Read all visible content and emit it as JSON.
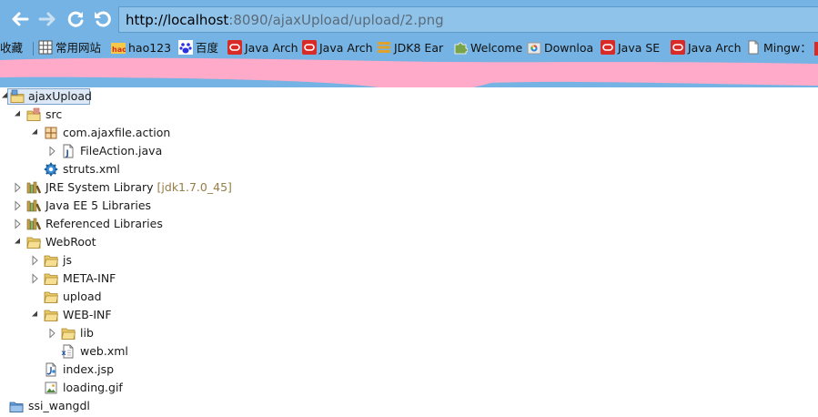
{
  "address": {
    "host_part": "http://localhost",
    "rest_part": ":8090/ajaxUpload/upload/2.png"
  },
  "bookmarks": [
    {
      "label": "收藏",
      "icon": "none"
    },
    {
      "label": "常用网站",
      "icon": "grid-icon"
    },
    {
      "label": "hao123",
      "icon": "hao123-icon"
    },
    {
      "label": "百度",
      "icon": "baidu-paw-icon"
    },
    {
      "label": "Java Arch",
      "icon": "oracle-icon"
    },
    {
      "label": "Java Arch",
      "icon": "oracle-icon"
    },
    {
      "label": "JDK8 Ear",
      "icon": "stack-icon"
    },
    {
      "label": "Welcome",
      "icon": "puzzle-icon"
    },
    {
      "label": "Downloa",
      "icon": "chrome-store-icon"
    },
    {
      "label": "Java SE",
      "icon": "oracle-icon"
    },
    {
      "label": "Java Arch",
      "icon": "oracle-icon"
    },
    {
      "label": "Mingw：",
      "icon": "page-icon"
    }
  ],
  "tree": [
    {
      "label": "ajaxUpload",
      "icon": "project-icon",
      "twisty": "expanded",
      "selected": true
    },
    {
      "label": "src",
      "icon": "source-folder-icon",
      "twisty": "expanded"
    },
    {
      "label": "com.ajaxfile.action",
      "icon": "package-icon",
      "twisty": "expanded"
    },
    {
      "label": "FileAction.java",
      "icon": "java-file-icon",
      "twisty": "collapsed"
    },
    {
      "label": "struts.xml",
      "icon": "gear-icon",
      "twisty": "none"
    },
    {
      "label": "JRE System Library",
      "decoration": "[jdk1.7.0_45]",
      "icon": "library-icon",
      "twisty": "collapsed"
    },
    {
      "label": "Java EE 5 Libraries",
      "icon": "library-icon",
      "twisty": "collapsed"
    },
    {
      "label": "Referenced Libraries",
      "icon": "library-icon",
      "twisty": "collapsed"
    },
    {
      "label": "WebRoot",
      "icon": "folder-icon",
      "twisty": "expanded"
    },
    {
      "label": "js",
      "icon": "folder-icon",
      "twisty": "collapsed"
    },
    {
      "label": "META-INF",
      "icon": "folder-icon",
      "twisty": "collapsed"
    },
    {
      "label": "upload",
      "icon": "folder-icon",
      "twisty": "none"
    },
    {
      "label": "WEB-INF",
      "icon": "folder-icon",
      "twisty": "expanded"
    },
    {
      "label": "lib",
      "icon": "folder-icon",
      "twisty": "collapsed"
    },
    {
      "label": "web.xml",
      "icon": "xml-file-icon",
      "twisty": "none"
    },
    {
      "label": "index.jsp",
      "icon": "jsp-file-icon",
      "twisty": "none"
    },
    {
      "label": "loading.gif",
      "icon": "image-file-icon",
      "twisty": "none"
    },
    {
      "label": "ssi_wangdl",
      "icon": "closed-project-icon",
      "twisty": "none"
    }
  ]
}
